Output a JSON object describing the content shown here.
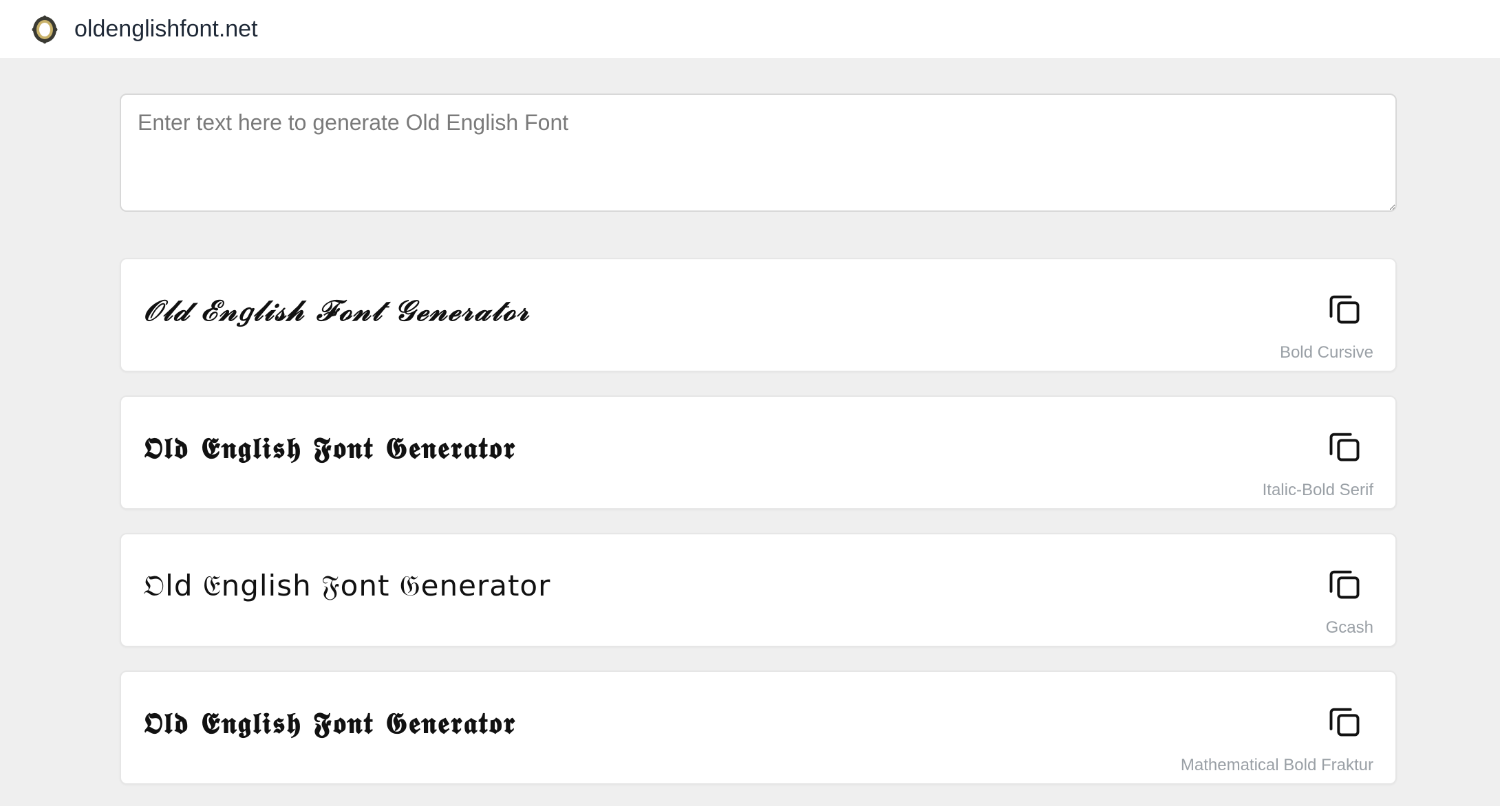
{
  "header": {
    "site_name": "oldenglishfont.net",
    "logo_icon": "ornate-frame-logo"
  },
  "input": {
    "value": "",
    "placeholder": "Enter text here to generate Old English Font"
  },
  "results": [
    {
      "text": "𝒪𝓁𝒹 ℰ𝓃𝑔𝓁𝒾𝓈𝒽 ℱℴ𝓃𝓉 𝒢ℯ𝓃ℯ𝓇𝒶𝓉ℴ𝓇",
      "label": "Bold Cursive",
      "icon": "copy-icon"
    },
    {
      "text": "𝕺𝖑𝖉 𝕰𝖓𝖌𝖑𝖎𝖘𝖍 𝕱𝖔𝖓𝖙 𝕲𝖊𝖓𝖊𝖗𝖆𝖙𝖔𝖗",
      "label": "Italic-Bold Serif",
      "icon": "copy-icon"
    },
    {
      "text": "𝔒ld 𝔈nglish 𝔉ont 𝔊enerator",
      "label": "Gcash",
      "icon": "copy-icon"
    },
    {
      "text": "𝕺𝖑𝖉 𝕰𝖓𝖌𝖑𝖎𝖘𝖍 𝕱𝖔𝖓𝖙 𝕲𝖊𝖓𝖊𝖗𝖆𝖙𝖔𝖗",
      "label": "Mathematical Bold Fraktur",
      "icon": "copy-icon"
    }
  ],
  "colors": {
    "background": "#efefef",
    "card": "#ffffff",
    "label": "#9aa0a6"
  }
}
